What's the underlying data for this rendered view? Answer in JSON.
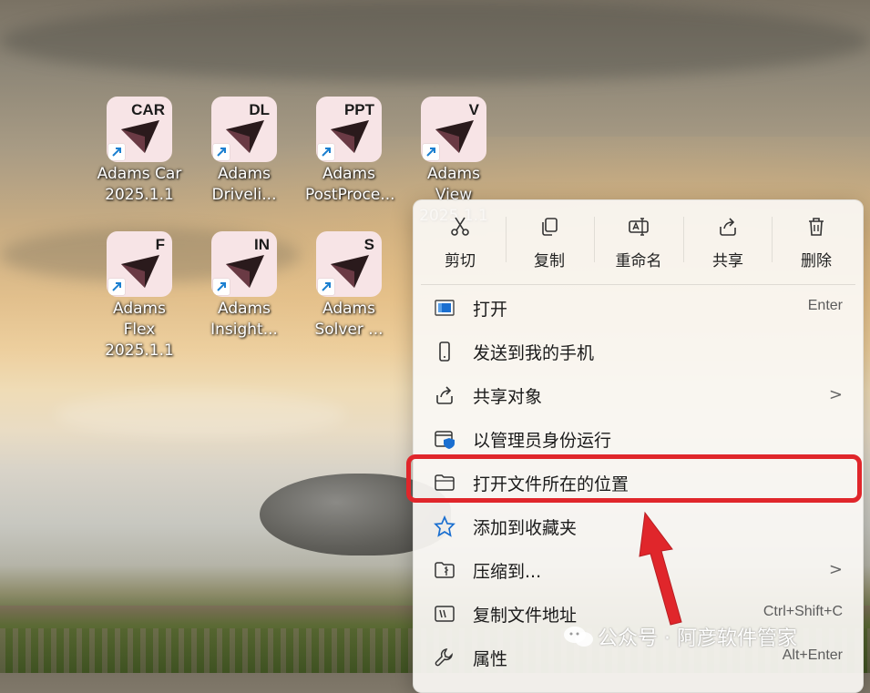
{
  "desktop": {
    "icons": [
      {
        "abbr": "CAR",
        "label": "Adams Car\n2025.1.1"
      },
      {
        "abbr": "DL",
        "label": "Adams\nDriveli..."
      },
      {
        "abbr": "PPT",
        "label": "Adams\nPostProce..."
      },
      {
        "abbr": "V",
        "label": "Adams View\n2025.1.1"
      },
      {
        "abbr": "F",
        "label": "Adams Flex\n2025.1.1"
      },
      {
        "abbr": "IN",
        "label": "Adams\nInsight..."
      },
      {
        "abbr": "S",
        "label": "Adams\nSolver ..."
      }
    ]
  },
  "context_menu": {
    "toolbar": [
      {
        "label": "剪切",
        "icon": "scissors-icon"
      },
      {
        "label": "复制",
        "icon": "copy-icon"
      },
      {
        "label": "重命名",
        "icon": "rename-icon"
      },
      {
        "label": "共享",
        "icon": "share-icon"
      },
      {
        "label": "删除",
        "icon": "trash-icon"
      }
    ],
    "items": [
      {
        "label": "打开",
        "shortcut": "Enter",
        "icon": "open-app-icon"
      },
      {
        "label": "发送到我的手机",
        "shortcut": "",
        "icon": "phone-icon"
      },
      {
        "label": "共享对象",
        "shortcut": "",
        "icon": "share-icon",
        "submenu": ">"
      },
      {
        "label": "以管理员身份运行",
        "shortcut": "",
        "icon": "admin-shield-icon"
      },
      {
        "label": "打开文件所在的位置",
        "shortcut": "",
        "icon": "folder-icon"
      },
      {
        "label": "添加到收藏夹",
        "shortcut": "",
        "icon": "star-icon"
      },
      {
        "label": "压缩到...",
        "shortcut": "",
        "icon": "zip-folder-icon",
        "submenu": ">"
      },
      {
        "label": "复制文件地址",
        "shortcut": "Ctrl+Shift+C",
        "icon": "copy-path-icon"
      },
      {
        "label": "属性",
        "shortcut": "Alt+Enter",
        "icon": "wrench-icon"
      }
    ]
  },
  "watermark": {
    "text": "公众号 · 阿彦软件管家"
  },
  "colors": {
    "highlight": "#e0262b",
    "arrow": "#e0262b",
    "icon_tile": "#f7e4e6"
  }
}
